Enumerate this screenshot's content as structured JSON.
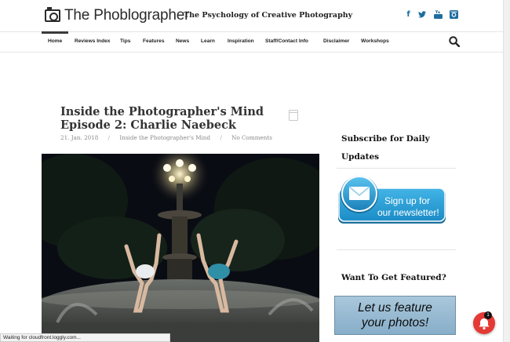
{
  "brand": {
    "name": "The Phoblographer",
    "tagline": "The Psychology of Creative Photography"
  },
  "social": [
    {
      "icon": "facebook-icon",
      "glyph": "f"
    },
    {
      "icon": "twitter-icon",
      "glyph": "t"
    },
    {
      "icon": "youtube-icon",
      "glyph": "▶"
    },
    {
      "icon": "instagram-icon",
      "glyph": "◎"
    }
  ],
  "nav": {
    "items": [
      "Home",
      "Reviews Index",
      "Tips",
      "Features",
      "News",
      "Learn",
      "Inspiration",
      "Staff/Contact Info",
      "Disclaimer",
      "Workshops"
    ],
    "active": "Home"
  },
  "article": {
    "title_line1": "Inside the Photographer's Mind",
    "title_line2": "Episode 2: Charlie Naebeck",
    "date": "21. Jan. 2018",
    "category": "Inside the Photographer's Mind",
    "comments": "No Comments",
    "separator": "/"
  },
  "sidebar": {
    "subscribe_line1": "Subscribe for Daily",
    "subscribe_line2": "Updates",
    "newsletter_line1": "Sign up for",
    "newsletter_line2": "our newsletter!",
    "featured_heading": "Want To Get Featured?",
    "featured_line1": "Let us feature",
    "featured_line2": "your photos!"
  },
  "status": {
    "text": "Waiting for cloudfront.loggly.com..."
  },
  "notification": {
    "count": "1"
  },
  "colors": {
    "accent": "#1f6d9e",
    "notification": "#e53935",
    "newsletter": "#2a9fd6"
  }
}
